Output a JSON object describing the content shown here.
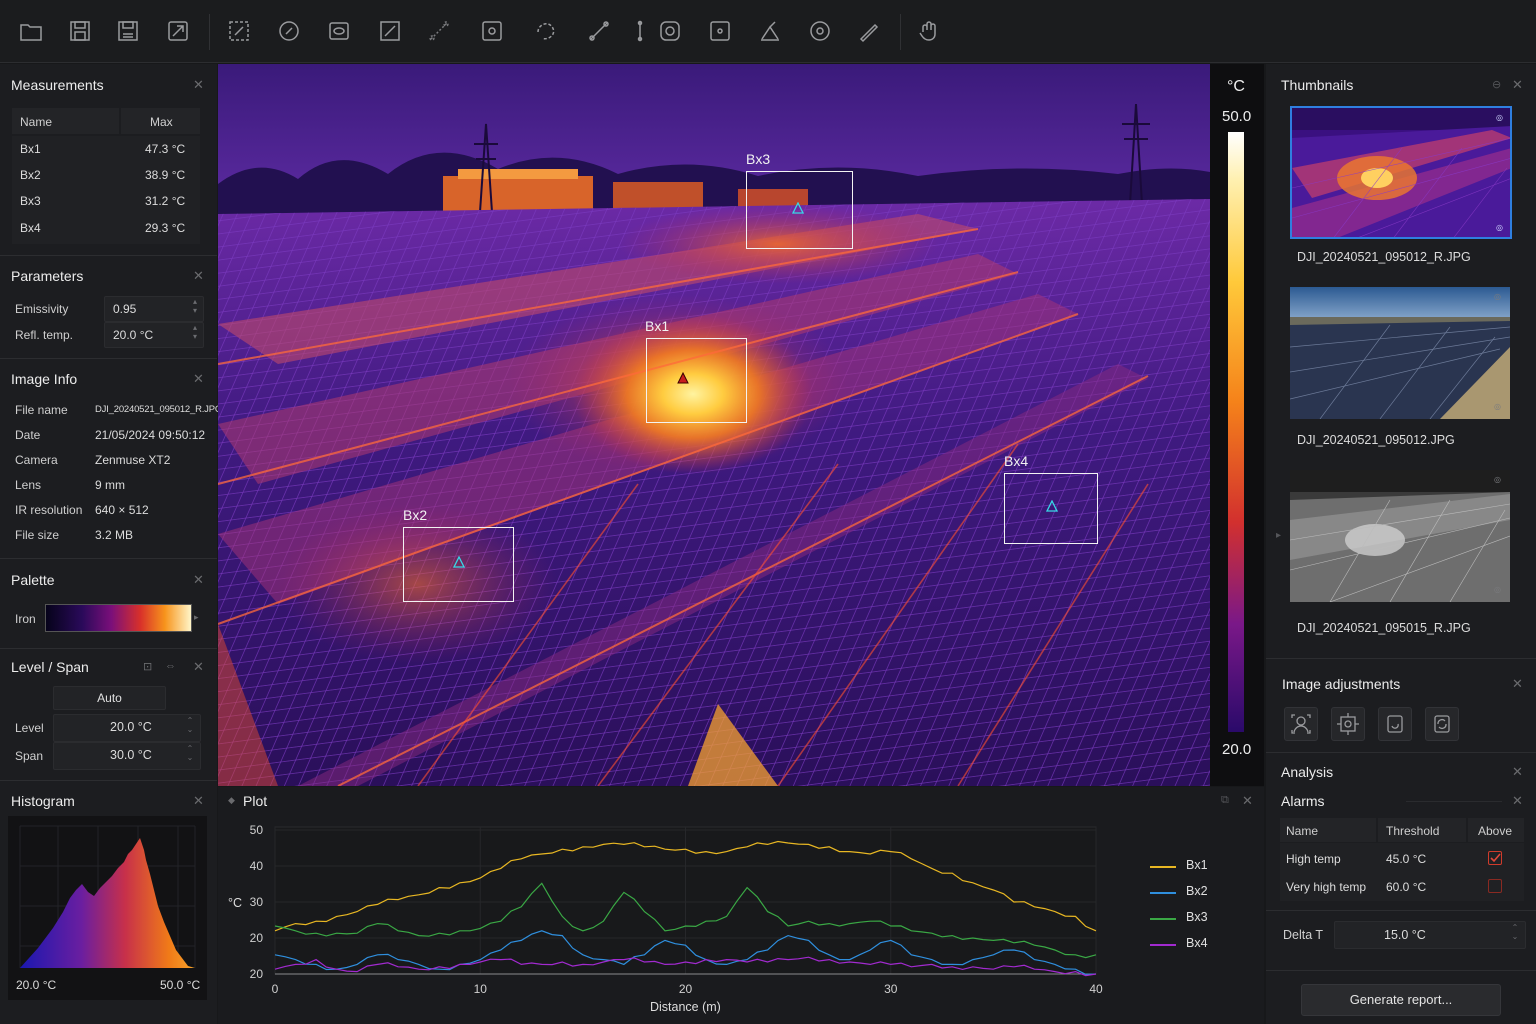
{
  "toolbar": {
    "tools": [
      "open-file-icon",
      "save-icon",
      "save-as-icon",
      "export-icon",
      "box-roi-icon",
      "ellipse-roi-icon",
      "polygon-roi-icon",
      "line-roi-icon",
      "polyline-roi-icon",
      "spot-icon",
      "freehand-roi-icon",
      "measure-line-icon",
      "isotherm-icon",
      "hotspot-icon",
      "annotation-icon",
      "target-icon",
      "pipette-icon",
      "hand-icon"
    ]
  },
  "measurements": {
    "title": "Measurements",
    "col_name": "Name",
    "col_max": "Max",
    "rows": [
      {
        "name": "Bx1",
        "max": "47.3 °C"
      },
      {
        "name": "Bx2",
        "max": "38.9 °C"
      },
      {
        "name": "Bx3",
        "max": "31.2 °C"
      },
      {
        "name": "Bx4",
        "max": "29.3 °C"
      }
    ]
  },
  "parameters": {
    "title": "Parameters",
    "emissivity_label": "Emissivity",
    "emissivity_value": "0.95",
    "refl_label": "Refl. temp.",
    "refl_value": "20.0 °C"
  },
  "image_info": {
    "title": "Image Info",
    "rows": [
      {
        "label": "File name",
        "value": "DJI_20240521_095012_R.JPG"
      },
      {
        "label": "Date",
        "value": "21/05/2024 09:50:12"
      },
      {
        "label": "Camera",
        "value": "Zenmuse XT2"
      },
      {
        "label": "Lens",
        "value": "9 mm"
      },
      {
        "label": "IR resolution",
        "value": "640 × 512"
      },
      {
        "label": "File size",
        "value": "3.2 MB"
      }
    ]
  },
  "palette": {
    "title": "Palette",
    "name": "Iron"
  },
  "level_span": {
    "title": "Level / Span",
    "auto_label": "Auto",
    "level_label": "Level",
    "level_value": "20.0 °C",
    "span_label": "Span",
    "span_value": "30.0 °C"
  },
  "histogram": {
    "title": "Histogram",
    "min_label": "20.0 °C",
    "max_label": "50.0 °C"
  },
  "thermal": {
    "rois": [
      {
        "label": "Bx1",
        "hot": true
      },
      {
        "label": "Bx2",
        "hot": false
      },
      {
        "label": "Bx3",
        "hot": false
      },
      {
        "label": "Bx4",
        "hot": false
      }
    ]
  },
  "scale": {
    "unit": "°C",
    "max": "50.0",
    "min": "20.0"
  },
  "plot": {
    "title": "Plot",
    "ylabel": "°C",
    "xlabel": "Distance (m)"
  },
  "chart_data": {
    "type": "line",
    "xlabel": "Distance (m)",
    "ylabel": "°C",
    "xlim": [
      0,
      40
    ],
    "ylim": [
      20,
      50
    ],
    "xticks": [
      "0",
      "10",
      "20",
      "30",
      "40"
    ],
    "yticks": [
      "50",
      "40",
      "30",
      "20",
      "20"
    ],
    "x": [
      0,
      1,
      2,
      3,
      4,
      5,
      6,
      7,
      8,
      9,
      10,
      11,
      12,
      13,
      14,
      15,
      16,
      17,
      18,
      19,
      20,
      21,
      22,
      23,
      24,
      25,
      26,
      27,
      28,
      29,
      30,
      31,
      32,
      33,
      34,
      35,
      36,
      37,
      38,
      39,
      40
    ],
    "series": [
      {
        "name": "Bx1",
        "color": "#e8b723",
        "values": [
          29,
          30.5,
          31,
          32,
          33,
          34.5,
          35.5,
          36.5,
          38,
          39,
          40,
          42,
          44,
          45,
          46,
          46.5,
          47,
          47,
          46.5,
          46,
          46,
          45.5,
          45.5,
          46.5,
          47,
          47.3,
          47,
          46.5,
          45.5,
          45,
          45.5,
          44,
          42,
          41,
          39,
          37.5,
          35,
          34,
          33,
          32,
          29
        ]
      },
      {
        "name": "Bx2",
        "color": "#2f8fde",
        "values": [
          24,
          23,
          22,
          21,
          22,
          24,
          23,
          22,
          21,
          22,
          23,
          25,
          27,
          29,
          28,
          24,
          23,
          22,
          24,
          27,
          26,
          23,
          22,
          23,
          25,
          28,
          27,
          24,
          23,
          25,
          27,
          24,
          23,
          22,
          23,
          24,
          25,
          23,
          22,
          21,
          20
        ]
      },
      {
        "name": "Bx3",
        "color": "#3aa845",
        "values": [
          30,
          29,
          28.5,
          28.5,
          28.5,
          30.5,
          29,
          28,
          28.5,
          29,
          29.5,
          31,
          34,
          38.9,
          32,
          29,
          31,
          37,
          33,
          29,
          30,
          31,
          32,
          38,
          33,
          30,
          31,
          30.5,
          30.5,
          31,
          30,
          29,
          28.5,
          28,
          27.5,
          27,
          26.5,
          26,
          25,
          24,
          24
        ]
      },
      {
        "name": "Bx4",
        "color": "#a22ad0",
        "values": [
          21,
          22,
          23,
          21,
          20.5,
          22,
          21.5,
          21,
          21.5,
          22,
          22.5,
          23,
          22,
          22,
          22.5,
          22,
          22.5,
          23,
          22.5,
          22,
          22.5,
          23,
          23,
          22.5,
          22.5,
          23,
          23.5,
          23,
          22.5,
          22,
          22,
          21.5,
          22,
          21.5,
          21.5,
          21,
          21.5,
          21,
          20.5,
          20.5,
          20
        ]
      }
    ]
  },
  "thumbnails": {
    "title": "Thumbnails",
    "items": [
      {
        "name": "DJI_20240521_095012_R.JPG"
      },
      {
        "name": "DJI_20240521_095012.JPG"
      },
      {
        "name": "DJI_20240521_095015_R.JPG"
      }
    ]
  },
  "image_adjustments": {
    "title": "Image adjustments",
    "icons": [
      "face-detect-icon",
      "auto-adjust-icon",
      "rotate-icon",
      "refresh-icon"
    ]
  },
  "analysis": {
    "title": "Analysis",
    "alarms_title": "Alarms",
    "col_name": "Name",
    "col_threshold": "Threshold",
    "col_above": "Above",
    "rows": [
      {
        "name": "High temp",
        "threshold": "45.0 °C",
        "above": true
      },
      {
        "name": "Very high temp",
        "threshold": "60.0 °C",
        "above": false
      }
    ],
    "delta_label": "Delta T",
    "delta_value": "15.0 °C"
  },
  "report_button": "Generate report...",
  "colors": {
    "accent": "#2f7fe0",
    "alarm": "#d03b2b",
    "panel": "#1c1d20"
  }
}
